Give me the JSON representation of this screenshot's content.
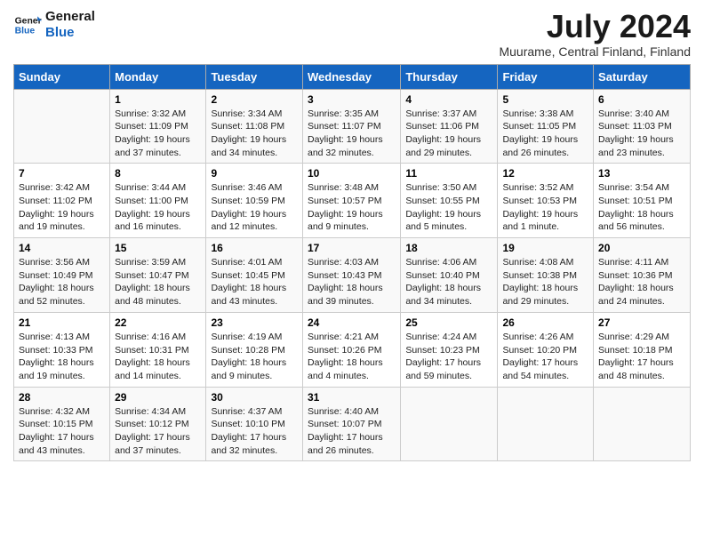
{
  "logo": {
    "text_general": "General",
    "text_blue": "Blue"
  },
  "title": "July 2024",
  "location": "Muurame, Central Finland, Finland",
  "days_of_week": [
    "Sunday",
    "Monday",
    "Tuesday",
    "Wednesday",
    "Thursday",
    "Friday",
    "Saturday"
  ],
  "weeks": [
    [
      {
        "day": "",
        "info": ""
      },
      {
        "day": "1",
        "info": "Sunrise: 3:32 AM\nSunset: 11:09 PM\nDaylight: 19 hours and 37 minutes."
      },
      {
        "day": "2",
        "info": "Sunrise: 3:34 AM\nSunset: 11:08 PM\nDaylight: 19 hours and 34 minutes."
      },
      {
        "day": "3",
        "info": "Sunrise: 3:35 AM\nSunset: 11:07 PM\nDaylight: 19 hours and 32 minutes."
      },
      {
        "day": "4",
        "info": "Sunrise: 3:37 AM\nSunset: 11:06 PM\nDaylight: 19 hours and 29 minutes."
      },
      {
        "day": "5",
        "info": "Sunrise: 3:38 AM\nSunset: 11:05 PM\nDaylight: 19 hours and 26 minutes."
      },
      {
        "day": "6",
        "info": "Sunrise: 3:40 AM\nSunset: 11:03 PM\nDaylight: 19 hours and 23 minutes."
      }
    ],
    [
      {
        "day": "7",
        "info": "Sunrise: 3:42 AM\nSunset: 11:02 PM\nDaylight: 19 hours and 19 minutes."
      },
      {
        "day": "8",
        "info": "Sunrise: 3:44 AM\nSunset: 11:00 PM\nDaylight: 19 hours and 16 minutes."
      },
      {
        "day": "9",
        "info": "Sunrise: 3:46 AM\nSunset: 10:59 PM\nDaylight: 19 hours and 12 minutes."
      },
      {
        "day": "10",
        "info": "Sunrise: 3:48 AM\nSunset: 10:57 PM\nDaylight: 19 hours and 9 minutes."
      },
      {
        "day": "11",
        "info": "Sunrise: 3:50 AM\nSunset: 10:55 PM\nDaylight: 19 hours and 5 minutes."
      },
      {
        "day": "12",
        "info": "Sunrise: 3:52 AM\nSunset: 10:53 PM\nDaylight: 19 hours and 1 minute."
      },
      {
        "day": "13",
        "info": "Sunrise: 3:54 AM\nSunset: 10:51 PM\nDaylight: 18 hours and 56 minutes."
      }
    ],
    [
      {
        "day": "14",
        "info": "Sunrise: 3:56 AM\nSunset: 10:49 PM\nDaylight: 18 hours and 52 minutes."
      },
      {
        "day": "15",
        "info": "Sunrise: 3:59 AM\nSunset: 10:47 PM\nDaylight: 18 hours and 48 minutes."
      },
      {
        "day": "16",
        "info": "Sunrise: 4:01 AM\nSunset: 10:45 PM\nDaylight: 18 hours and 43 minutes."
      },
      {
        "day": "17",
        "info": "Sunrise: 4:03 AM\nSunset: 10:43 PM\nDaylight: 18 hours and 39 minutes."
      },
      {
        "day": "18",
        "info": "Sunrise: 4:06 AM\nSunset: 10:40 PM\nDaylight: 18 hours and 34 minutes."
      },
      {
        "day": "19",
        "info": "Sunrise: 4:08 AM\nSunset: 10:38 PM\nDaylight: 18 hours and 29 minutes."
      },
      {
        "day": "20",
        "info": "Sunrise: 4:11 AM\nSunset: 10:36 PM\nDaylight: 18 hours and 24 minutes."
      }
    ],
    [
      {
        "day": "21",
        "info": "Sunrise: 4:13 AM\nSunset: 10:33 PM\nDaylight: 18 hours and 19 minutes."
      },
      {
        "day": "22",
        "info": "Sunrise: 4:16 AM\nSunset: 10:31 PM\nDaylight: 18 hours and 14 minutes."
      },
      {
        "day": "23",
        "info": "Sunrise: 4:19 AM\nSunset: 10:28 PM\nDaylight: 18 hours and 9 minutes."
      },
      {
        "day": "24",
        "info": "Sunrise: 4:21 AM\nSunset: 10:26 PM\nDaylight: 18 hours and 4 minutes."
      },
      {
        "day": "25",
        "info": "Sunrise: 4:24 AM\nSunset: 10:23 PM\nDaylight: 17 hours and 59 minutes."
      },
      {
        "day": "26",
        "info": "Sunrise: 4:26 AM\nSunset: 10:20 PM\nDaylight: 17 hours and 54 minutes."
      },
      {
        "day": "27",
        "info": "Sunrise: 4:29 AM\nSunset: 10:18 PM\nDaylight: 17 hours and 48 minutes."
      }
    ],
    [
      {
        "day": "28",
        "info": "Sunrise: 4:32 AM\nSunset: 10:15 PM\nDaylight: 17 hours and 43 minutes."
      },
      {
        "day": "29",
        "info": "Sunrise: 4:34 AM\nSunset: 10:12 PM\nDaylight: 17 hours and 37 minutes."
      },
      {
        "day": "30",
        "info": "Sunrise: 4:37 AM\nSunset: 10:10 PM\nDaylight: 17 hours and 32 minutes."
      },
      {
        "day": "31",
        "info": "Sunrise: 4:40 AM\nSunset: 10:07 PM\nDaylight: 17 hours and 26 minutes."
      },
      {
        "day": "",
        "info": ""
      },
      {
        "day": "",
        "info": ""
      },
      {
        "day": "",
        "info": ""
      }
    ]
  ]
}
